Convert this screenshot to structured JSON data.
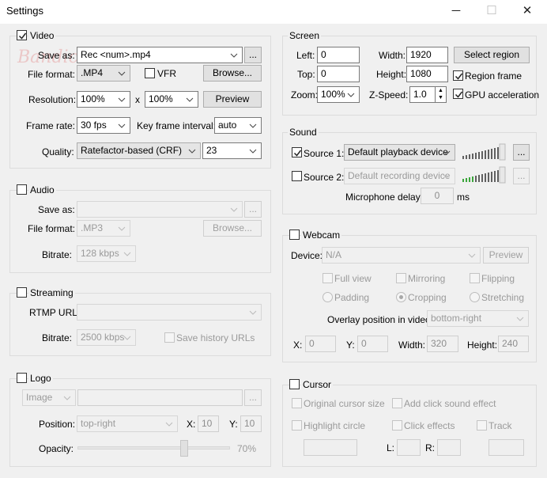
{
  "window": {
    "title": "Settings",
    "minimize": "─",
    "maximize": "☐",
    "close": "✕"
  },
  "video": {
    "group_label": "Video",
    "enabled": true,
    "save_as_label": "Save as:",
    "save_as_value": "Rec <num>.mp4",
    "ellipsis": "...",
    "file_format_label": "File format:",
    "file_format_value": ".MP4",
    "vfr_label": "VFR",
    "browse_label": "Browse...",
    "resolution_label": "Resolution:",
    "res_w": "100%",
    "res_x": "x",
    "res_h": "100%",
    "preview_label": "Preview",
    "frame_rate_label": "Frame rate:",
    "frame_rate_value": "30 fps",
    "keyframe_label": "Key frame interval:",
    "keyframe_value": "auto",
    "quality_label": "Quality:",
    "quality_mode": "Ratefactor-based (CRF)",
    "quality_value": "23"
  },
  "screen": {
    "group_label": "Screen",
    "left_label": "Left:",
    "left_value": "0",
    "top_label": "Top:",
    "top_value": "0",
    "width_label": "Width:",
    "width_value": "1920",
    "height_label": "Height:",
    "height_value": "1080",
    "select_region_label": "Select region",
    "region_frame_label": "Region frame",
    "region_frame_checked": true,
    "zoom_label": "Zoom:",
    "zoom_value": "100%",
    "zspeed_label": "Z-Speed:",
    "zspeed_value": "1.0",
    "gpu_label": "GPU acceleration",
    "gpu_checked": true
  },
  "sound": {
    "group_label": "Sound",
    "source1_label": "Source 1:",
    "source1_value": "Default playback device",
    "source1_checked": true,
    "source2_label": "Source 2:",
    "source2_value": "Default recording device",
    "source2_checked": false,
    "ellipsis": "...",
    "mic_delay_label": "Microphone delay:",
    "mic_delay_value": "0",
    "mic_delay_unit": "ms"
  },
  "audio": {
    "group_label": "Audio",
    "save_as_label": "Save as:",
    "ellipsis": "...",
    "file_format_label": "File format:",
    "file_format_value": ".MP3",
    "browse_label": "Browse...",
    "bitrate_label": "Bitrate:",
    "bitrate_value": "128 kbps"
  },
  "streaming": {
    "group_label": "Streaming",
    "rtmp_label": "RTMP URL:",
    "bitrate_label": "Bitrate:",
    "bitrate_value": "2500 kbps",
    "save_history_label": "Save history URLs"
  },
  "logo": {
    "group_label": "Logo",
    "type_value": "Image",
    "ellipsis": "...",
    "position_label": "Position:",
    "position_value": "top-right",
    "x_label": "X:",
    "x_value": "10",
    "y_label": "Y:",
    "y_value": "10",
    "opacity_label": "Opacity:",
    "opacity_value": "70%",
    "opacity_fraction": 0.7
  },
  "webcam": {
    "group_label": "Webcam",
    "device_label": "Device:",
    "device_value": "N/A",
    "preview_label": "Preview",
    "full_view": "Full view",
    "mirroring": "Mirroring",
    "flipping": "Flipping",
    "padding": "Padding",
    "cropping": "Cropping",
    "stretching": "Stretching",
    "overlay_label": "Overlay position in video:",
    "overlay_value": "bottom-right",
    "x_label": "X:",
    "x_value": "0",
    "y_label": "Y:",
    "y_value": "0",
    "width_label": "Width:",
    "width_value": "320",
    "height_label": "Height:",
    "height_value": "240"
  },
  "cursor": {
    "group_label": "Cursor",
    "original_size": "Original cursor size",
    "click_sound": "Add click sound effect",
    "highlight_circle": "Highlight circle",
    "click_effects": "Click effects",
    "track": "Track",
    "l_label": "L:",
    "r_label": "R:"
  }
}
